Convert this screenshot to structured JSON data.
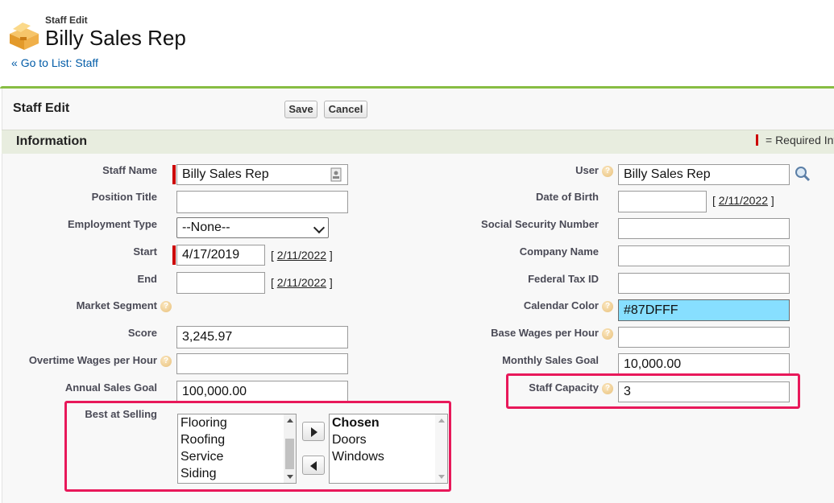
{
  "header": {
    "subtitle": "Staff Edit",
    "title": "Billy Sales Rep",
    "back_prefix": "«",
    "back_link": "Go to List: Staff"
  },
  "page_block": {
    "title": "Staff Edit",
    "save_label": "Save",
    "cancel_label": "Cancel"
  },
  "section": {
    "title": "Information",
    "required_legend": "= Required Inf"
  },
  "left_fields": {
    "staff_name": {
      "label": "Staff Name",
      "value": "Billy Sales Rep"
    },
    "position_title": {
      "label": "Position Title",
      "value": ""
    },
    "employment_type": {
      "label": "Employment Type",
      "value": "--None--"
    },
    "start": {
      "label": "Start",
      "value": "4/17/2019",
      "today": "2/11/2022"
    },
    "end": {
      "label": "End",
      "value": "",
      "today": "2/11/2022"
    },
    "market_segment": {
      "label": "Market Segment"
    },
    "score": {
      "label": "Score",
      "value": "3,245.97"
    },
    "overtime_wages": {
      "label": "Overtime Wages per Hour",
      "value": ""
    },
    "annual_sales_goal": {
      "label": "Annual Sales Goal",
      "value": "100,000.00"
    },
    "best_at_selling": {
      "label": "Best at Selling",
      "available": [
        "Flooring",
        "Roofing",
        "Service",
        "Siding"
      ],
      "chosen_header": "Chosen",
      "chosen": [
        "Doors",
        "Windows"
      ]
    }
  },
  "right_fields": {
    "user": {
      "label": "User",
      "value": "Billy Sales Rep"
    },
    "date_of_birth": {
      "label": "Date of Birth",
      "value": "",
      "today": "2/11/2022"
    },
    "ssn": {
      "label": "Social Security Number",
      "value": ""
    },
    "company_name": {
      "label": "Company Name",
      "value": ""
    },
    "federal_tax_id": {
      "label": "Federal Tax ID",
      "value": ""
    },
    "calendar_color": {
      "label": "Calendar Color",
      "value": "#87DFFF"
    },
    "base_wages": {
      "label": "Base Wages per Hour",
      "value": ""
    },
    "monthly_sales_goal": {
      "label": "Monthly Sales Goal",
      "value": "10,000.00"
    },
    "staff_capacity": {
      "label": "Staff Capacity",
      "value": "3"
    }
  },
  "colors": {
    "accent_green": "#87bd43",
    "required_red": "#cc0000",
    "highlight_pink": "#e8185a",
    "calendar_color_fill": "#87DFFF",
    "link_blue": "#015ba7"
  }
}
